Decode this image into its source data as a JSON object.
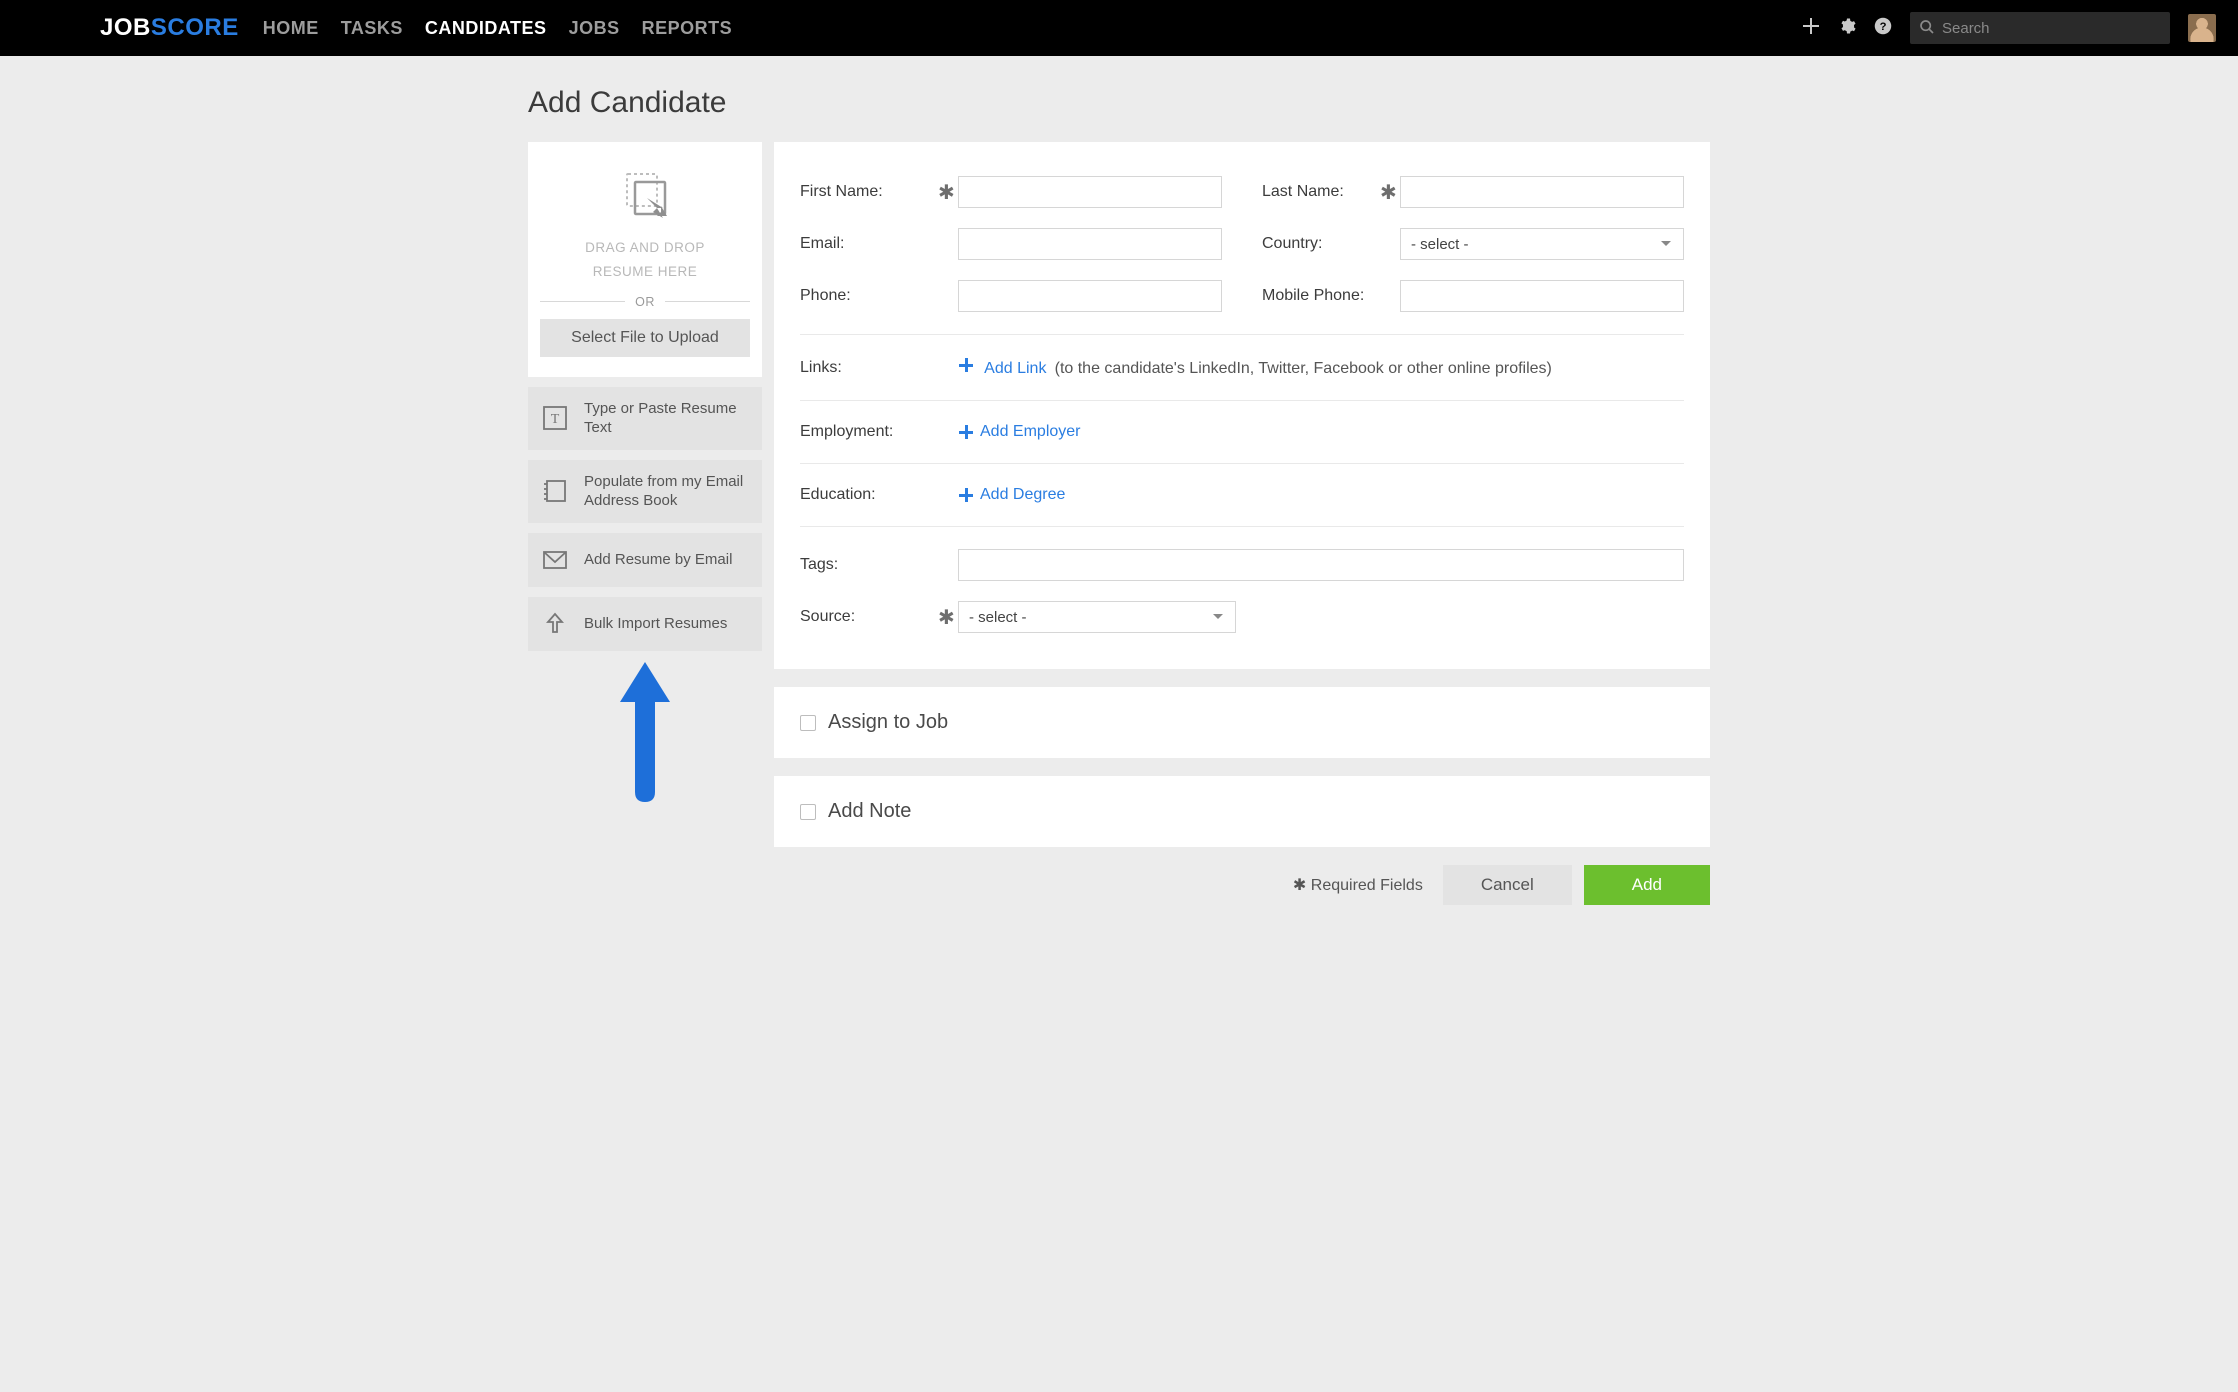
{
  "nav": {
    "logo_a": "JOB",
    "logo_b": "SCORE",
    "links": [
      "HOME",
      "TASKS",
      "CANDIDATES",
      "JOBS",
      "REPORTS"
    ],
    "active_index": 2,
    "search_placeholder": "Search"
  },
  "page": {
    "title": "Add Candidate"
  },
  "upload": {
    "drop_line1": "DRAG AND DROP",
    "drop_line2": "RESUME HERE",
    "or_label": "OR",
    "select_button": "Select File to Upload"
  },
  "sidebar": {
    "items": [
      {
        "label": "Type or Paste Resume Text",
        "icon": "text"
      },
      {
        "label": "Populate from my Email Address Book",
        "icon": "contacts"
      },
      {
        "label": "Add Resume by Email",
        "icon": "envelope"
      },
      {
        "label": "Bulk Import Resumes",
        "icon": "upload"
      }
    ]
  },
  "form": {
    "first_name_label": "First Name:",
    "last_name_label": "Last Name:",
    "email_label": "Email:",
    "country_label": "Country:",
    "country_value": "- select -",
    "phone_label": "Phone:",
    "mobile_label": "Mobile Phone:",
    "links_label": "Links:",
    "add_link_text": "Add Link",
    "add_link_hint": "(to the candidate's LinkedIn, Twitter, Facebook or other online profiles)",
    "employment_label": "Employment:",
    "add_employer_text": "Add Employer",
    "education_label": "Education:",
    "add_degree_text": "Add Degree",
    "tags_label": "Tags:",
    "source_label": "Source:",
    "source_value": "- select -"
  },
  "sections": {
    "assign_job": "Assign to Job",
    "add_note": "Add Note"
  },
  "footer": {
    "required_note": "Required Fields",
    "required_mark": "✱",
    "cancel": "Cancel",
    "add": "Add"
  }
}
